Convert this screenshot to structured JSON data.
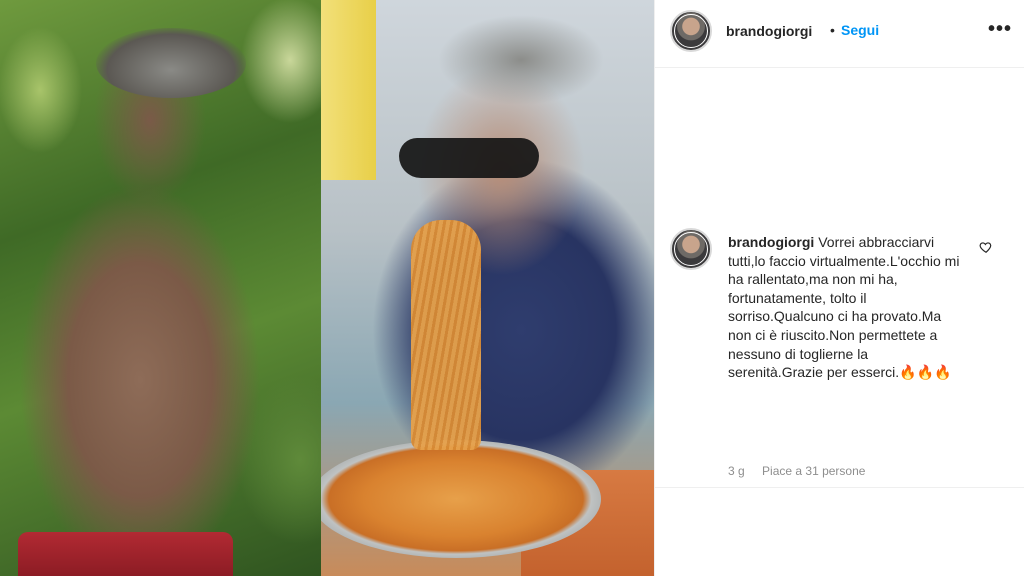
{
  "post": {
    "username": "brandogiorgi",
    "separator": "•",
    "follow_label": "Segui",
    "more_icon": "more-horizontal-icon",
    "more_glyph": "•••"
  },
  "caption": {
    "username": "brandogiorgi",
    "text": "Vorrei abbracciarvi tutti,lo faccio virtualmente.L'occhio mi ha rallentato,ma non mi ha, fortunatamente, tolto il sorriso.Qualcuno ci ha provato.Ma non ci è riuscito.Non permettete a nessuno di toglierne la serenità.Grazie per esserci.🔥🔥🔥",
    "time": "3 g",
    "likes": "Piace a 31 persone",
    "heart_icon": "heart-outline-icon"
  },
  "colors": {
    "follow": "#0095f6",
    "text": "#262626",
    "muted": "#8e8e8e",
    "divider": "#efefef"
  }
}
